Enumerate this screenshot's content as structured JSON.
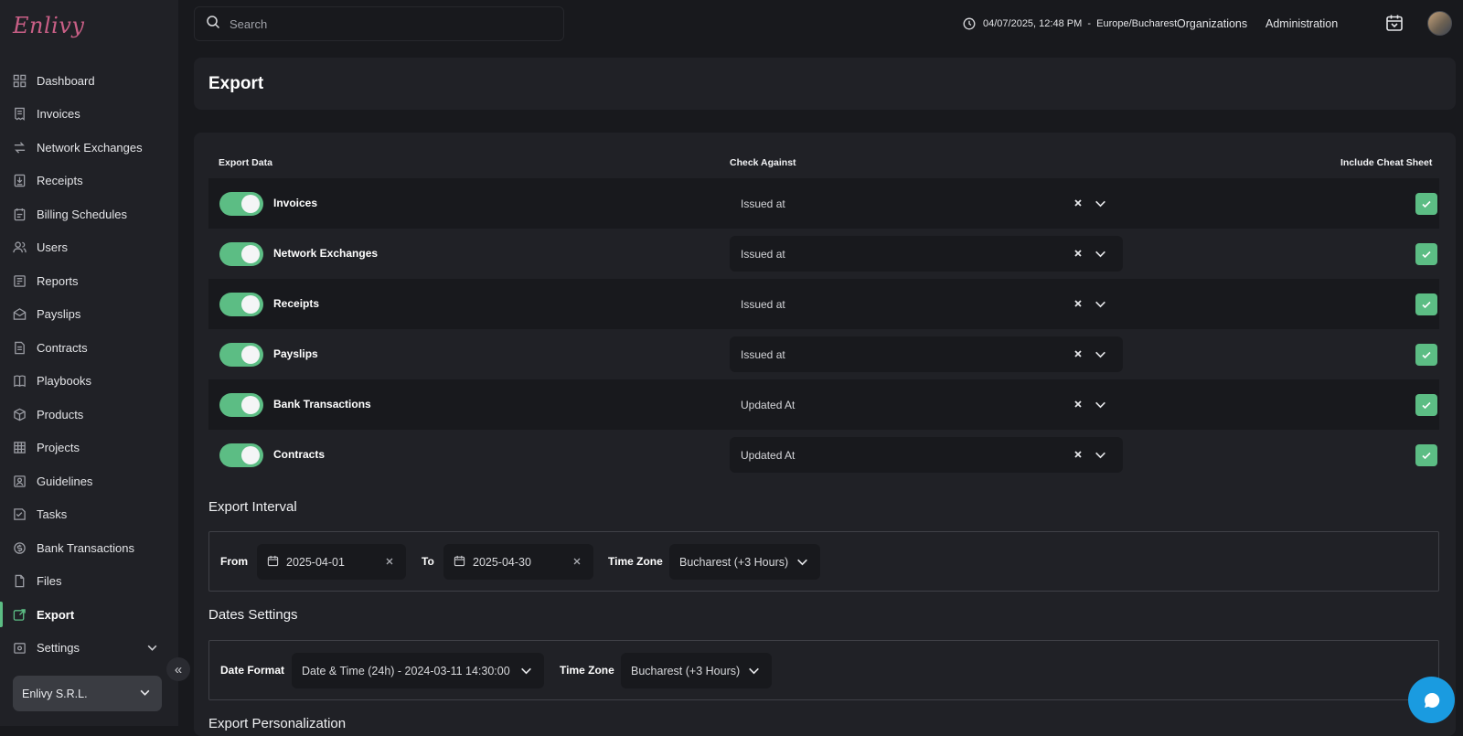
{
  "app": {
    "logo_text": "Enlivy",
    "accent": "#5cbd84"
  },
  "sidebar": {
    "items": [
      {
        "label": "Dashboard",
        "icon": "dashboard-icon"
      },
      {
        "label": "Invoices",
        "icon": "invoice-icon"
      },
      {
        "label": "Network Exchanges",
        "icon": "exchange-icon"
      },
      {
        "label": "Receipts",
        "icon": "receipt-icon"
      },
      {
        "label": "Billing Schedules",
        "icon": "billing-icon"
      },
      {
        "label": "Users",
        "icon": "users-icon"
      },
      {
        "label": "Reports",
        "icon": "reports-icon"
      },
      {
        "label": "Payslips",
        "icon": "payslip-icon"
      },
      {
        "label": "Contracts",
        "icon": "contract-icon"
      },
      {
        "label": "Playbooks",
        "icon": "playbook-icon"
      },
      {
        "label": "Products",
        "icon": "box-icon"
      },
      {
        "label": "Projects",
        "icon": "projects-icon"
      },
      {
        "label": "Guidelines",
        "icon": "guidelines-icon"
      },
      {
        "label": "Tasks",
        "icon": "tasks-icon"
      },
      {
        "label": "Bank Transactions",
        "icon": "bank-icon"
      },
      {
        "label": "Files",
        "icon": "file-icon"
      },
      {
        "label": "Export",
        "icon": "export-icon",
        "active": true
      },
      {
        "label": "Settings",
        "icon": "settings-icon"
      }
    ],
    "organization": "Enlivy S.R.L."
  },
  "topbar": {
    "search_placeholder": "Search",
    "datetime": "04/07/2025, 12:48 PM  -  Europe/Bucharest",
    "organizations": "Organizations",
    "administration": "Administration"
  },
  "page": {
    "title": "Export"
  },
  "table": {
    "headers": {
      "export_data": "Export Data",
      "check_against": "Check Against",
      "cheat_sheet": "Include Cheat Sheet"
    },
    "rows": [
      {
        "label": "Invoices",
        "check_against": "Issued at",
        "enabled": true,
        "cheat_sheet": true
      },
      {
        "label": "Network Exchanges",
        "check_against": "Issued at",
        "enabled": true,
        "cheat_sheet": true
      },
      {
        "label": "Receipts",
        "check_against": "Issued at",
        "enabled": true,
        "cheat_sheet": true
      },
      {
        "label": "Payslips",
        "check_against": "Issued at",
        "enabled": true,
        "cheat_sheet": true
      },
      {
        "label": "Bank Transactions",
        "check_against": "Updated At",
        "enabled": true,
        "cheat_sheet": true
      },
      {
        "label": "Contracts",
        "check_against": "Updated At",
        "enabled": true,
        "cheat_sheet": true
      }
    ]
  },
  "export_interval": {
    "heading": "Export Interval",
    "from_label": "From",
    "from_value": "2025-04-01",
    "to_label": "To",
    "to_value": "2025-04-30",
    "timezone_label": "Time Zone",
    "timezone_value": "Bucharest (+3 Hours)"
  },
  "dates_settings": {
    "heading": "Dates Settings",
    "format_label": "Date Format",
    "format_value": "Date & Time (24h) - 2024-03-11 14:30:00",
    "timezone_label": "Time Zone",
    "timezone_value": "Bucharest (+3 Hours)"
  },
  "export_personalization": {
    "heading": "Export Personalization"
  }
}
